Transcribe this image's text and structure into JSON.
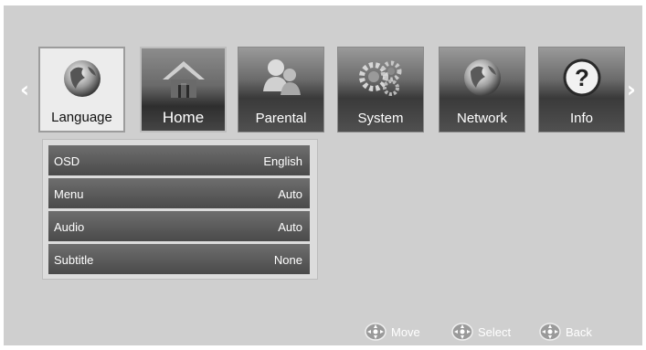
{
  "nav": {
    "left_arrow": "‹",
    "right_arrow": "›"
  },
  "tabs": [
    {
      "label": "Language",
      "icon": "globe-icon",
      "active": true
    },
    {
      "label": "Home",
      "icon": "house-icon",
      "active": false
    },
    {
      "label": "Parental",
      "icon": "people-icon",
      "active": false
    },
    {
      "label": "System",
      "icon": "gears-icon",
      "active": false
    },
    {
      "label": "Network",
      "icon": "globe-icon",
      "active": false
    },
    {
      "label": "Info",
      "icon": "question-icon",
      "active": false
    }
  ],
  "settings": [
    {
      "name": "OSD",
      "value": "English"
    },
    {
      "name": "Menu",
      "value": "Auto"
    },
    {
      "name": "Audio",
      "value": "Auto"
    },
    {
      "name": "Subtitle",
      "value": "None"
    }
  ],
  "hints": [
    {
      "icon": "dpad-icon",
      "label": "Move"
    },
    {
      "icon": "dpad-icon",
      "label": "Select"
    },
    {
      "icon": "dpad-icon",
      "label": "Back"
    }
  ],
  "colors": {
    "background": "#cfcfcf",
    "row": "#555555",
    "text": "#ffffff"
  }
}
